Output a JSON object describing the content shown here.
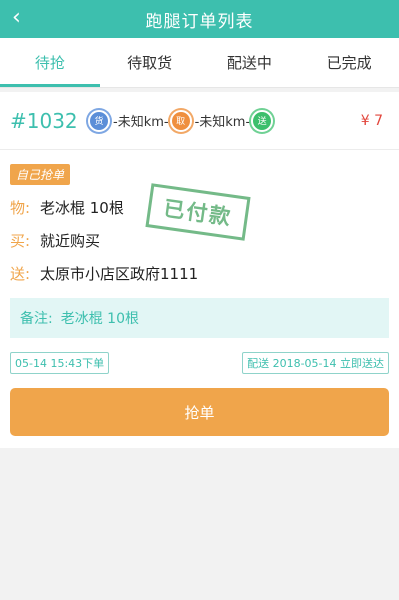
{
  "header": {
    "title": "跑腿订单列表",
    "back_glyph": "‹"
  },
  "tabs": [
    {
      "label": "待抢",
      "active": true
    },
    {
      "label": "待取货",
      "active": false
    },
    {
      "label": "配送中",
      "active": false
    },
    {
      "label": "已完成",
      "active": false
    }
  ],
  "order": {
    "number": "#1032",
    "route": {
      "buy_icon_text": "货",
      "distance1": "-未知km-",
      "take_icon_text": "取",
      "distance2": "-未知km-",
      "send_icon_text": "送"
    },
    "price": "¥ 7",
    "badge": "自己抢单",
    "stamp": "已付款",
    "item_label": "物:",
    "item_value": "老冰棍 10根",
    "buy_label": "买:",
    "buy_value": "就近购买",
    "send_label": "送:",
    "send_value": "太原市小店区政府1111",
    "note_label": "备注:",
    "note_value": "老冰棍 10根",
    "order_time": "05-14 15:43下单",
    "delivery_time": "配送 2018-05-14 立即送达",
    "grab_button": "抢单"
  },
  "colors": {
    "accent": "#3dbfae",
    "orange": "#f0a54b",
    "price": "#e2463c"
  }
}
